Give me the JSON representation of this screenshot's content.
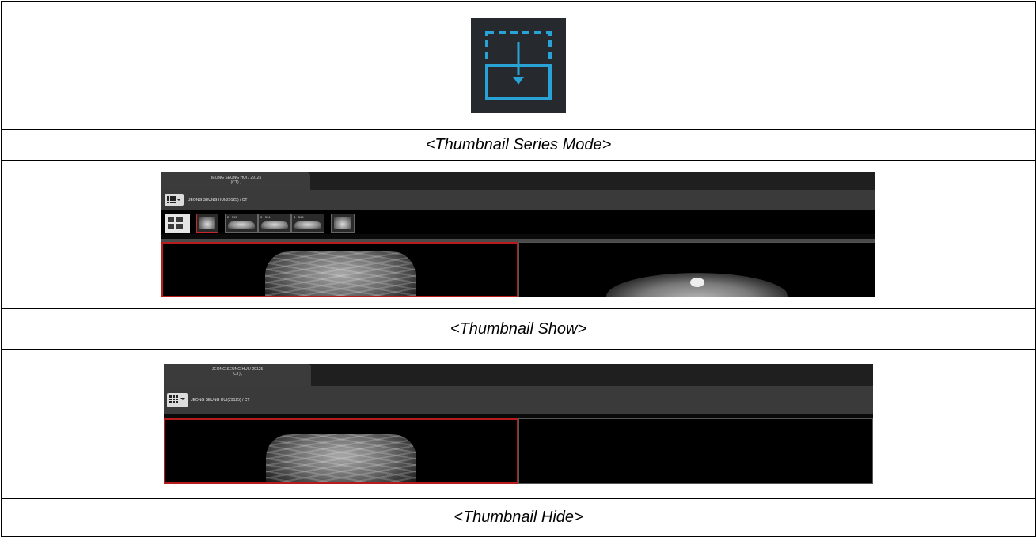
{
  "icon": {
    "name": "thumbnail-series-mode-icon",
    "bg_color": "#26292d",
    "accent_color": "#29a3d6"
  },
  "captions": {
    "series_mode": "<Thumbnail Series Mode>",
    "show": "<Thumbnail Show>",
    "hide": "<Thumbnail Hide>"
  },
  "viewer": {
    "tab_title_line1": "JEONG SEUNG HUI / 29125",
    "tab_title_line2": "(CT) ,",
    "series_path": "JEONG SEUNG HUI(29125) / CT",
    "thumbnails": [
      {
        "label": "",
        "kind": "xray"
      },
      {
        "label": "2 · 313",
        "kind": "ct"
      },
      {
        "label": "3 · 314",
        "kind": "ct"
      },
      {
        "label": "4 · 313",
        "kind": "ct"
      },
      {
        "label": "",
        "kind": "xray"
      }
    ],
    "active_viewport_color": "#b71c1c"
  }
}
